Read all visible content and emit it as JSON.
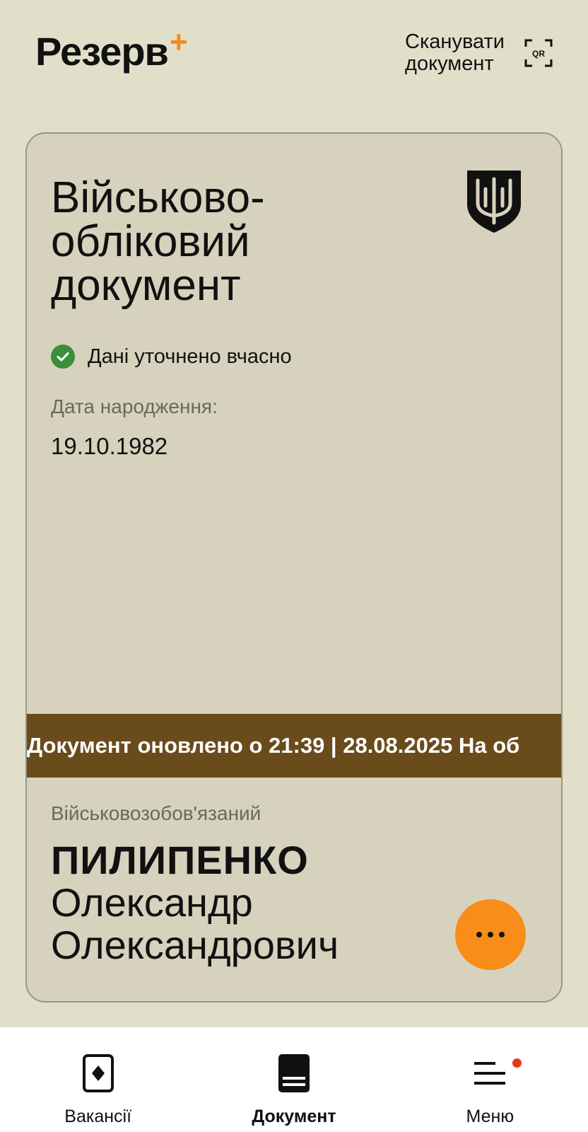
{
  "header": {
    "logo_text": "Резерв",
    "logo_plus": "+",
    "scan_label_line1": "Сканувати",
    "scan_label_line2": "документ",
    "qr_icon": "qr-scan-icon",
    "accent_color": "#f28a1c"
  },
  "card": {
    "title": "Військово-обліковий документ",
    "emblem_icon": "trident-shield-icon",
    "status_text": "Дані уточнено вчасно",
    "status_color": "#3a8f3a",
    "dob_label": "Дата народження:",
    "dob_value": "19.10.1982",
    "ticker_text": "Документ оновлено о 21:39 | 28.08.2025 На об",
    "ticker_color": "#6a4b1b",
    "role_label": "Військовозобов'язаний",
    "last_name": "ПИЛИПЕНКО",
    "first_name": "Олександр",
    "patronymic": "Олександрович",
    "more_button_color": "#f88d1a"
  },
  "bottom_nav": {
    "items": [
      {
        "label": "Вакансії",
        "icon": "vacancies-icon",
        "active": false
      },
      {
        "label": "Документ",
        "icon": "document-icon",
        "active": true
      },
      {
        "label": "Меню",
        "icon": "menu-icon",
        "active": false,
        "badge": true
      }
    ]
  }
}
